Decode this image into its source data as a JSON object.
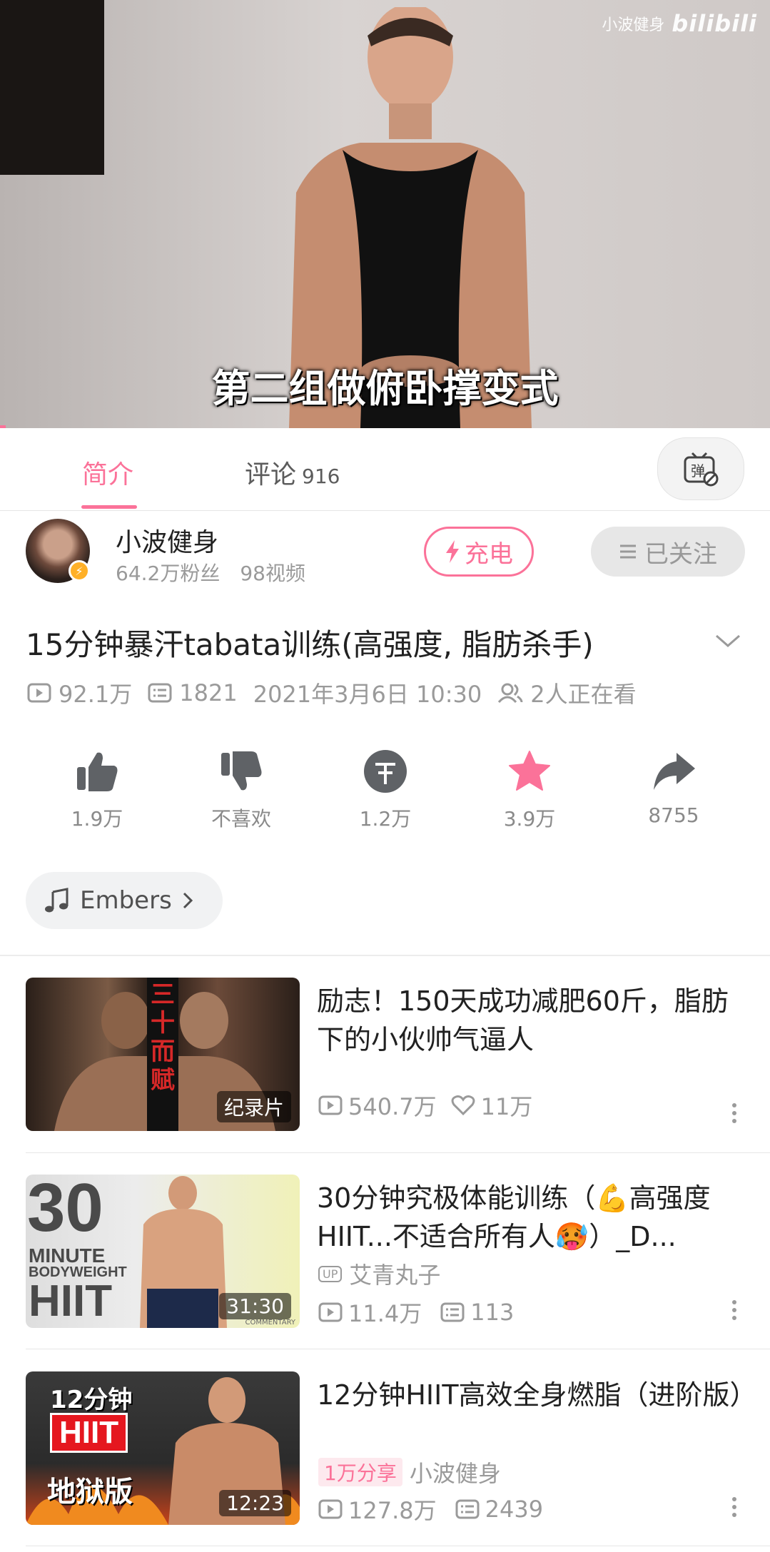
{
  "player": {
    "watermark_name": "小波健身",
    "watermark_logo": "bilibili",
    "subtitle": "第二组做俯卧撑变式"
  },
  "tabs": {
    "intro": "简介",
    "comments": "评论",
    "comments_count": "916",
    "danmaku_icon": "danmaku-toggle-icon"
  },
  "uploader": {
    "name": "小波健身",
    "fans": "64.2万粉丝",
    "videos": "98视频",
    "charge_label": "充电",
    "follow_label": "已关注"
  },
  "video": {
    "title": "15分钟暴汗tabata训练(高强度, 脂肪杀手)",
    "views": "92.1万",
    "danmaku": "1821",
    "date": "2021年3月6日 10:30",
    "watching": "2人正在看"
  },
  "actions": {
    "like": "1.9万",
    "dislike": "不喜欢",
    "coin": "1.2万",
    "favorite": "3.9万",
    "share": "8755"
  },
  "music": {
    "label": "Embers"
  },
  "recommendations": [
    {
      "title": "励志！150天成功减肥60斤，脂肪下的小伙帅气逼人",
      "badge": "纪录片",
      "views": "540.7万",
      "likes": "11万",
      "thumb_text": "三十而赋"
    },
    {
      "title": "30分钟究极体能训练（💪高强度HIIT...不适合所有人🥵）_D...",
      "duration": "31:30",
      "uploader": "艾青丸子",
      "views": "11.4万",
      "danmaku": "113",
      "thumb_big": "30",
      "thumb_line1": "MINUTE",
      "thumb_line2": "BODYWEIGHT",
      "thumb_line3": "HIIT",
      "thumb_small": "COMMENTARY"
    },
    {
      "title": "12分钟HIIT高效全身燃脂（进阶版）",
      "duration": "12:23",
      "share_tag": "1万分享",
      "uploader": "小波健身",
      "views": "127.8万",
      "danmaku": "2439",
      "thumb_line1": "12分钟",
      "thumb_line2": "HIIT",
      "thumb_line3": "地狱版"
    }
  ],
  "colors": {
    "accent": "#fb7299",
    "text": "#212121",
    "muted": "#9a9a9a"
  }
}
